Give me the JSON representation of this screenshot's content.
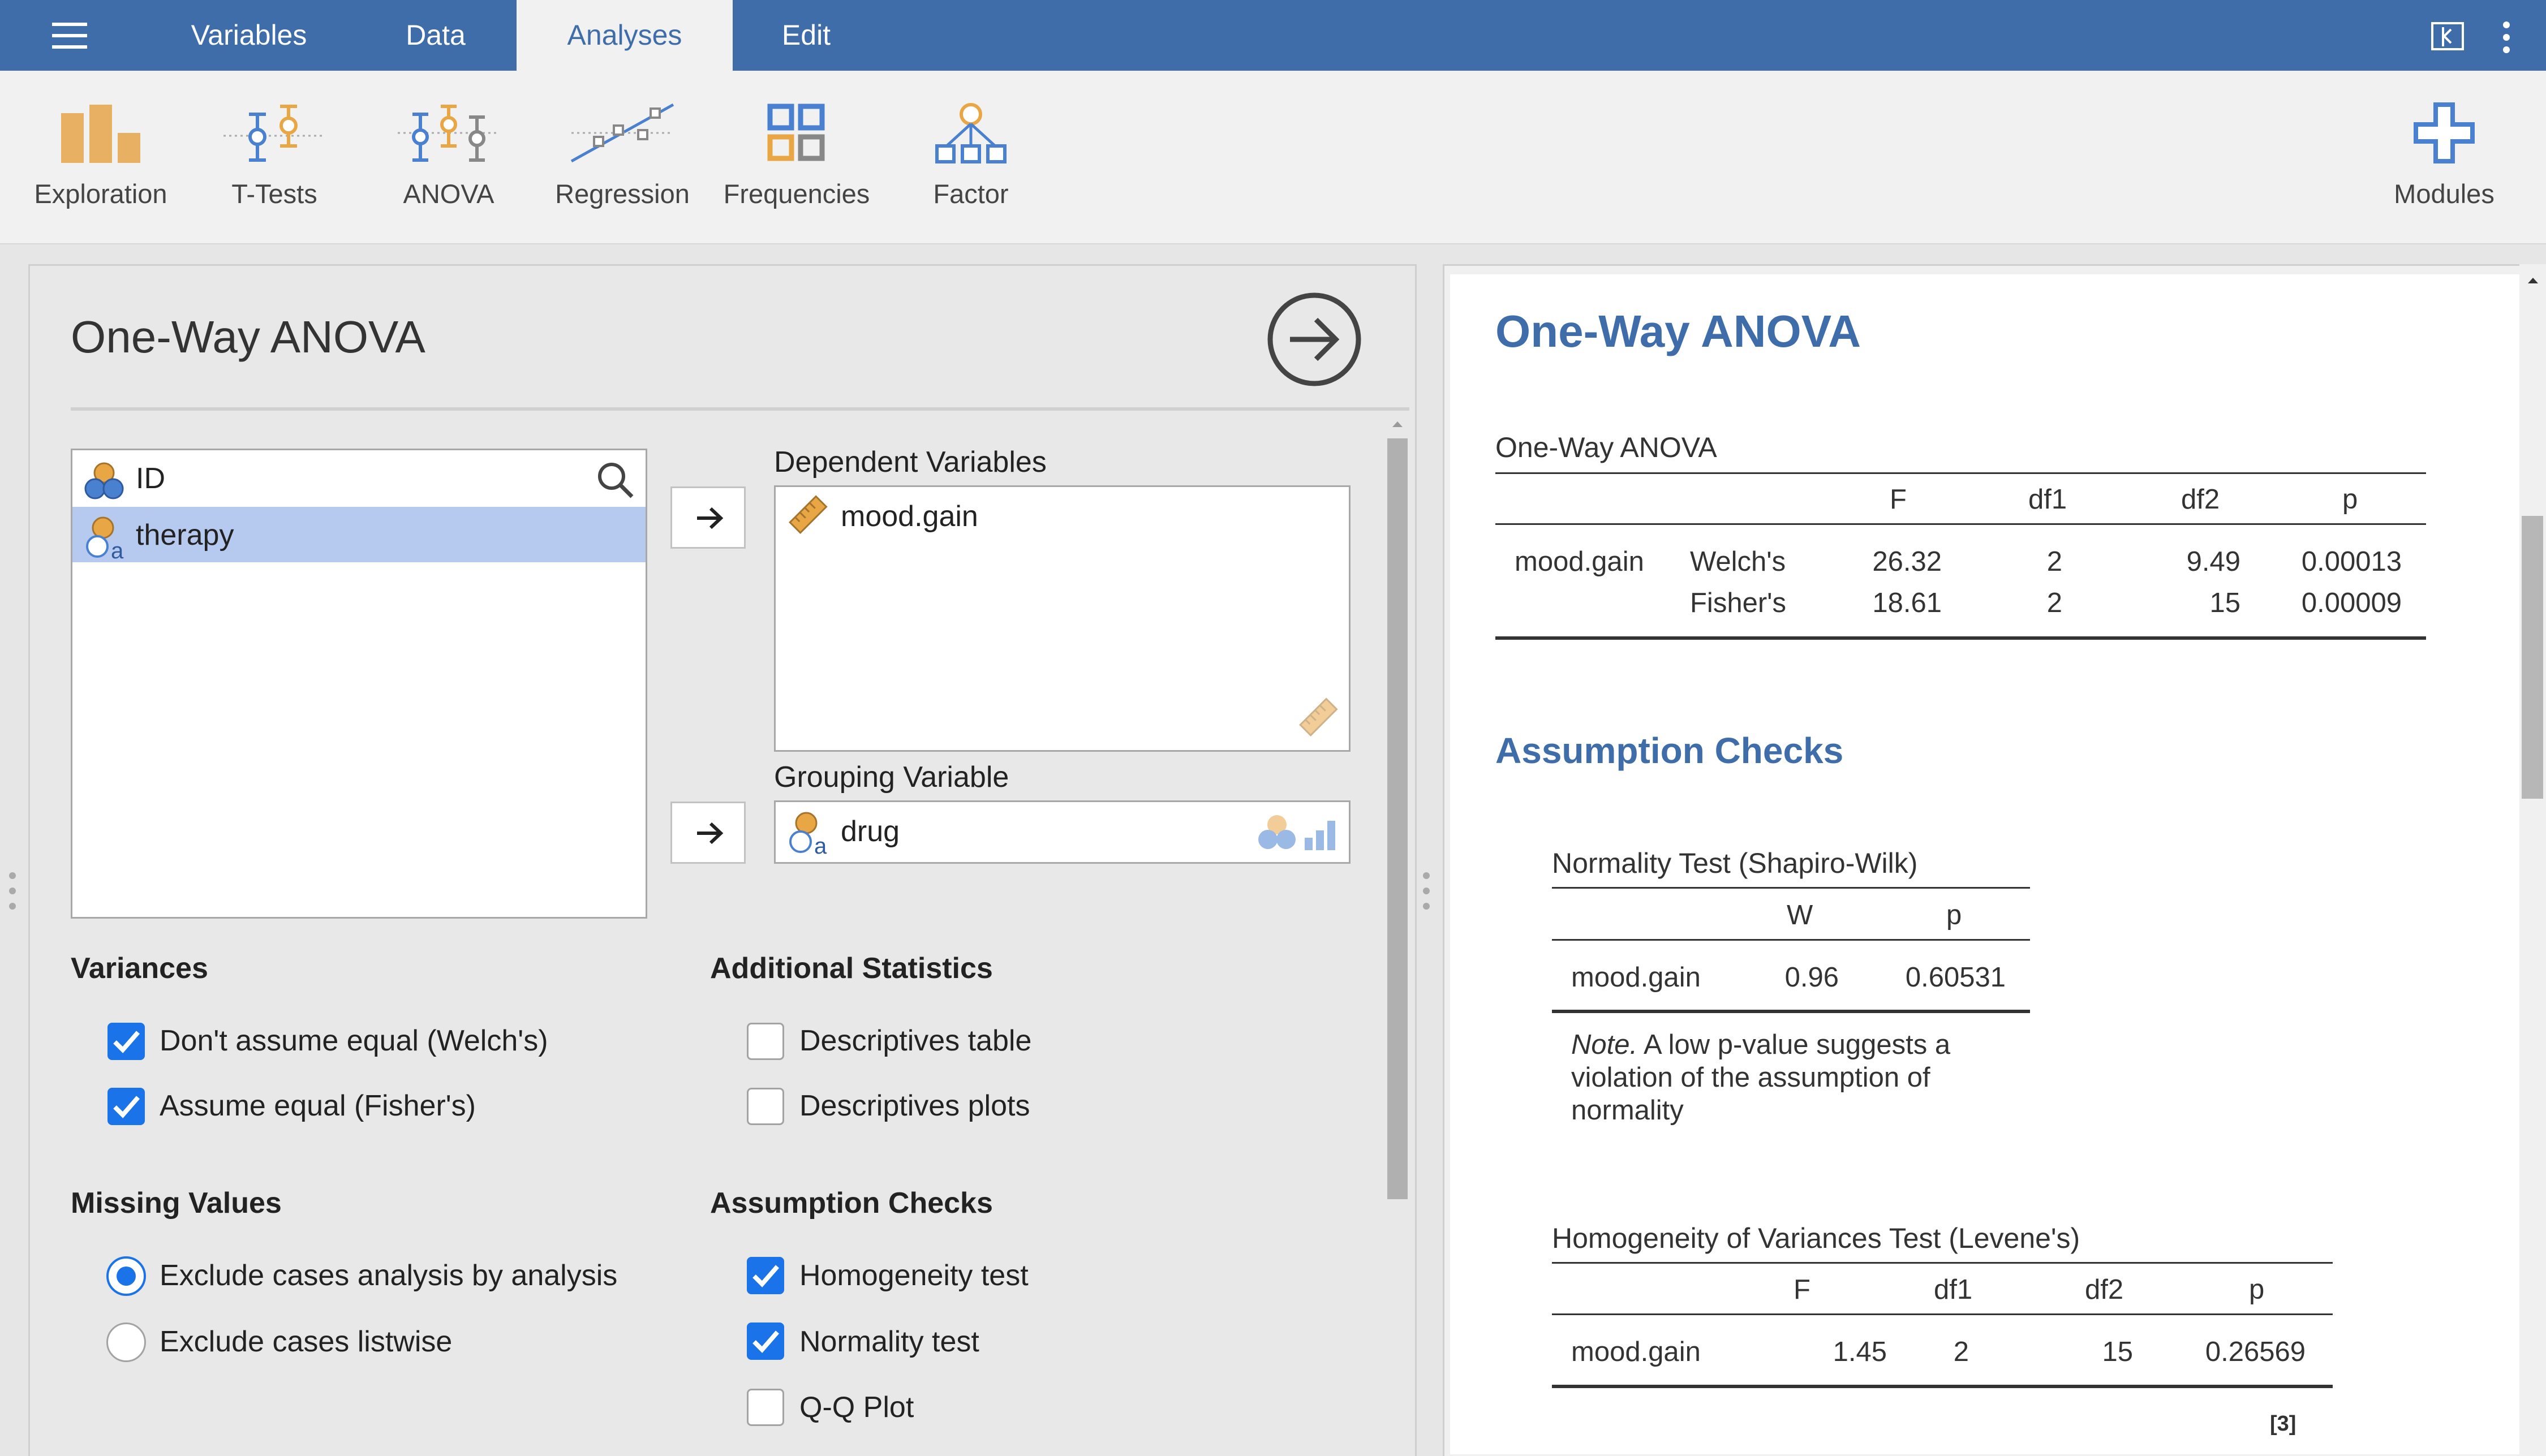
{
  "menubar": {
    "tabs": [
      "Variables",
      "Data",
      "Analyses",
      "Edit"
    ],
    "active_tab": "Analyses"
  },
  "ribbon": {
    "buttons": [
      "Exploration",
      "T-Tests",
      "ANOVA",
      "Regression",
      "Frequencies",
      "Factor"
    ],
    "modules": "Modules"
  },
  "options": {
    "title": "One-Way ANOVA",
    "variables": [
      "ID",
      "therapy"
    ],
    "dependent_label": "Dependent Variables",
    "dependent_vars": [
      "mood.gain"
    ],
    "grouping_label": "Grouping Variable",
    "grouping_var": "drug",
    "variances": {
      "heading": "Variances",
      "welch": "Don't assume equal (Welch's)",
      "welch_checked": true,
      "fisher": "Assume equal (Fisher's)",
      "fisher_checked": true
    },
    "additional": {
      "heading": "Additional Statistics",
      "desc_table": "Descriptives table",
      "desc_table_checked": false,
      "desc_plots": "Descriptives plots",
      "desc_plots_checked": false
    },
    "missing": {
      "heading": "Missing Values",
      "analysis": "Exclude cases analysis by analysis",
      "listwise": "Exclude cases listwise",
      "selected": "analysis"
    },
    "assumptions": {
      "heading": "Assumption Checks",
      "homogeneity": "Homogeneity test",
      "homogeneity_checked": true,
      "normality": "Normality test",
      "normality_checked": true,
      "qq": "Q-Q Plot",
      "qq_checked": false
    }
  },
  "results": {
    "title": "One-Way ANOVA",
    "anova_table": {
      "caption": "One-Way ANOVA",
      "headers": [
        "F",
        "df1",
        "df2",
        "p"
      ],
      "var": "mood.gain",
      "rows": [
        {
          "test": "Welch's",
          "F": "26.32",
          "df1": "2",
          "df2": "9.49",
          "p": "0.00013"
        },
        {
          "test": "Fisher's",
          "F": "18.61",
          "df1": "2",
          "df2": "15",
          "p": "0.00009"
        }
      ]
    },
    "assumption_heading": "Assumption Checks",
    "normality_table": {
      "caption": "Normality Test (Shapiro-Wilk)",
      "headers": [
        "W",
        "p"
      ],
      "row": {
        "var": "mood.gain",
        "W": "0.96",
        "p": "0.60531"
      },
      "note_label": "Note.",
      "note_line1": "A low p-value suggests a",
      "note_line2": "violation of the assumption of",
      "note_line3": "normality"
    },
    "levene_table": {
      "caption": "Homogeneity of Variances Test (Levene's)",
      "headers": [
        "F",
        "df1",
        "df2",
        "p"
      ],
      "row": {
        "var": "mood.gain",
        "F": "1.45",
        "df1": "2",
        "df2": "15",
        "p": "0.26569"
      }
    },
    "footnote": "[3]"
  },
  "colors": {
    "header_blue": "#3e6da9",
    "checkbox_blue": "#1a73e8",
    "icon_orange": "#e8a645",
    "icon_blue": "#4a80d0",
    "selection": "#b6c9ee"
  },
  "icons": [
    "hamburger-menu-icon",
    "exit-icon",
    "more-vert-icon",
    "run-arrow-icon",
    "search-icon",
    "nominal-variable-icon",
    "continuous-ruler-icon"
  ]
}
